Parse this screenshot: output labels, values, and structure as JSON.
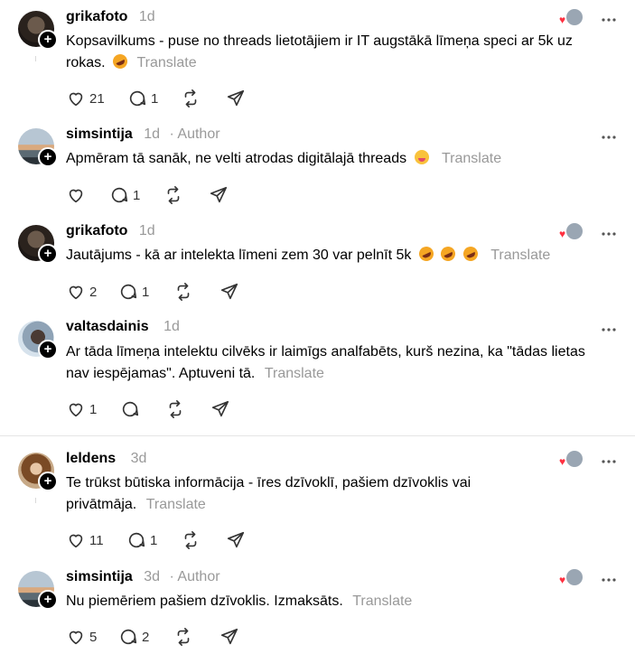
{
  "posts": [
    {
      "username": "grikafoto",
      "time": "1d",
      "author_badge": "",
      "text": "Kopsavilkums - puse no threads lietotājiem ir IT augstākā līmeņa speci ar 5k uz rokas.",
      "emojis": [
        "rolling-on-floor-laughing"
      ],
      "translate": "Translate",
      "likes": "21",
      "replies": "1",
      "liked_by_author": true
    },
    {
      "username": "simsintija",
      "time": "1d",
      "author_badge": "· Author",
      "text": "Apmēram tā sanāk, ne velti atrodas digitālajā threads",
      "emojis": [
        "zany-face"
      ],
      "translate": "Translate",
      "likes": "",
      "replies": "1",
      "liked_by_author": false
    },
    {
      "username": "grikafoto",
      "time": "1d",
      "author_badge": "",
      "text": "Jautājums - kā ar intelekta līmeni zem 30 var pelnīt 5k",
      "emojis": [
        "rolling-on-floor-laughing",
        "rolling-on-floor-laughing",
        "rolling-on-floor-laughing"
      ],
      "translate": "Translate",
      "likes": "2",
      "replies": "1",
      "liked_by_author": true
    },
    {
      "username": "valtasdainis",
      "time": "1d",
      "author_badge": "",
      "text": "Ar tāda līmeņa intelektu cilvēks ir laimīgs analfabēts, kurš nezina, ka \"tādas lietas nav iespējamas\". Aptuveni tā.",
      "emojis": [],
      "translate": "Translate",
      "likes": "1",
      "replies": "",
      "liked_by_author": false
    },
    {
      "username": "leldens",
      "time": "3d",
      "author_badge": "",
      "text": "Te trūkst būtiska informācija - īres dzīvoklī, pašiem dzīvoklis vai privātmāja.",
      "emojis": [],
      "translate": "Translate",
      "likes": "11",
      "replies": "1",
      "liked_by_author": true
    },
    {
      "username": "simsintija",
      "time": "3d",
      "author_badge": "· Author",
      "text": "Nu piemēriem pašiem dzīvoklis. Izmaksāts.",
      "emojis": [],
      "translate": "Translate",
      "likes": "5",
      "replies": "2",
      "liked_by_author": true
    }
  ],
  "icons": {
    "like": "heart-icon",
    "reply": "comment-icon",
    "repost": "repost-icon",
    "share": "send-icon",
    "more": "more-icon",
    "follow": "plus-icon"
  },
  "colors": {
    "muted": "#999999",
    "like_red": "#ff3040",
    "text": "#000000"
  }
}
